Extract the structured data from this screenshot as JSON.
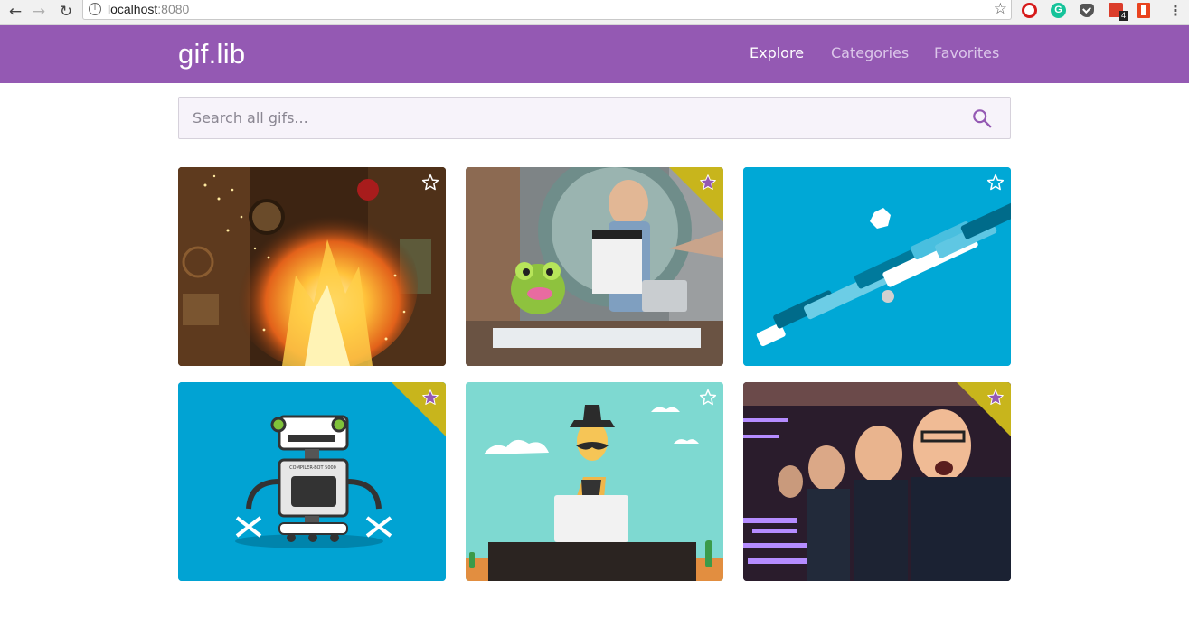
{
  "browser": {
    "url_host": "localhost",
    "url_port": ":8080",
    "todo_badge": "4"
  },
  "app": {
    "logo": "gif.lib",
    "nav": [
      {
        "label": "Explore",
        "active": true
      },
      {
        "label": "Categories",
        "active": false
      },
      {
        "label": "Favorites",
        "active": false
      }
    ]
  },
  "search": {
    "placeholder": "Search all gifs..."
  },
  "gifs": [
    {
      "subject": "fire explosion in cabin",
      "favorited": false
    },
    {
      "subject": "man with frog puppet and clapperboard",
      "favorited": true
    },
    {
      "subject": "falling domino blocks",
      "favorited": false
    },
    {
      "subject": "compiler-bot robot",
      "favorited": true
    },
    {
      "subject": "cowboy at laptop",
      "favorited": false
    },
    {
      "subject": "man in infinity mirror",
      "favorited": true
    }
  ],
  "robot_label": "COMPILER-BOT 5000",
  "colors": {
    "header": "#9459b3",
    "favorite_corner": "#c8b51c",
    "favorite_star": "#9459b3"
  }
}
